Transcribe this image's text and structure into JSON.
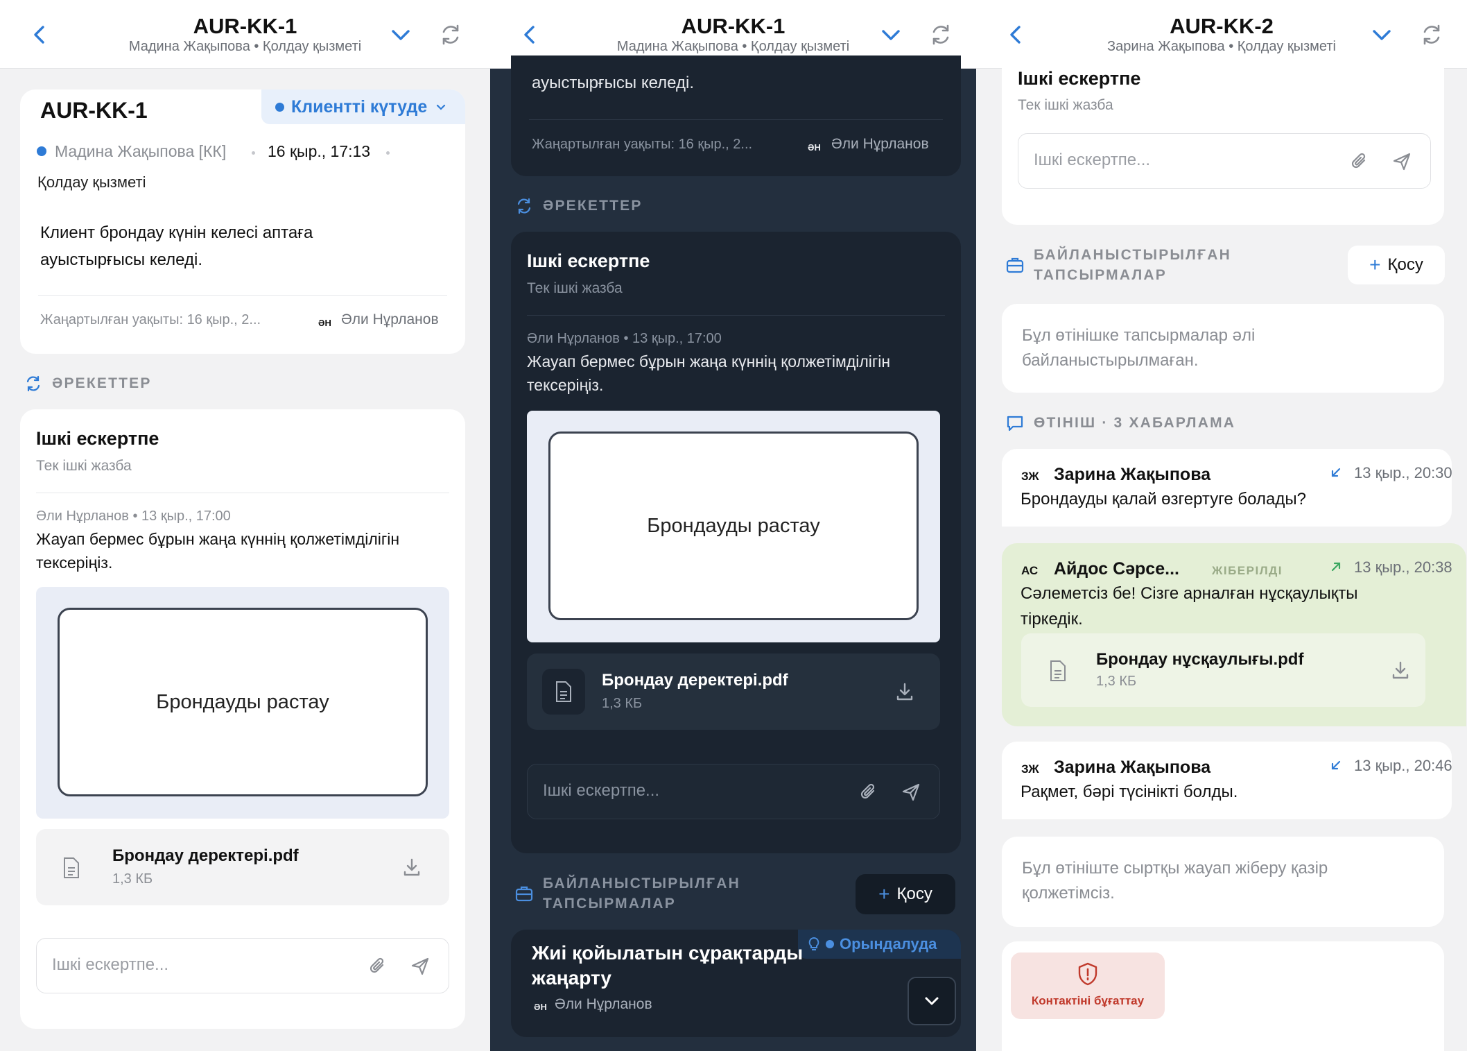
{
  "colors": {
    "accent": "#2e7bd6",
    "light_bg": "#f2f2f3",
    "dark_bg": "#232f3e",
    "dark_card": "#1b2430",
    "green_bubble": "#e4efd6",
    "danger": "#c0392b"
  },
  "panel1": {
    "header": {
      "title": "AUR-KK-1",
      "subtitle": "Мадина Жақыпова • Қолдау қызметі"
    },
    "ticket": {
      "id": "AUR-KK-1",
      "status": "Клиентті күтуде",
      "customer": "Мадина Жақыпова [КК]",
      "datetime": "16 қыр., 17:13",
      "department": "Қолдау қызметі",
      "message_line1": "Клиент брондау күнін келесі аптаға",
      "message_line2": "ауыстырғысы келеді.",
      "updated": "Жаңартылған уақыты: 16 қыр., 2...",
      "assignee_initials": "ӘН",
      "assignee": "Әли Нұрланов"
    },
    "actions_label": "ӘРЕКЕТТЕР",
    "note": {
      "title": "Ішкі ескертпе",
      "subtitle": "Тек ішкі жазба",
      "meta": "Әли Нұрланов • 13 қыр., 17:00",
      "text_line1": "Жауап бермес бұрын жаңа күннің қолжетімділігін",
      "text_line2": "тексеріңіз.",
      "image_button": "Брондауды растау",
      "file_name": "Брондау деректері.pdf",
      "file_size": "1,3 КБ",
      "input_placeholder": "Ішкі ескертпе..."
    }
  },
  "panel2": {
    "header": {
      "title": "AUR-KK-1",
      "subtitle": "Мадина Жақыпова • Қолдау қызметі"
    },
    "top_text": "ауыстырғысы келеді.",
    "updated": "Жаңартылған уақыты: 16 қыр., 2...",
    "assignee_initials": "ӘН",
    "assignee": "Әли Нұрланов",
    "actions_label": "ӘРЕКЕТТЕР",
    "note": {
      "title": "Ішкі ескертпе",
      "subtitle": "Тек ішкі жазба",
      "meta": "Әли Нұрланов • 13 қыр., 17:00",
      "text_line1": "Жауап бермес бұрын жаңа күннің қолжетімділігін",
      "text_line2": "тексеріңіз.",
      "image_button": "Брондауды растау",
      "file_name": "Брондау деректері.pdf",
      "file_size": "1,3 КБ",
      "input_placeholder": "Ішкі ескертпе..."
    },
    "linked_tasks_label_1": "БАЙЛАНЫСТЫРЫЛҒАН",
    "linked_tasks_label_2": "ТАПСЫРМАЛАР",
    "add_button": "Қосу",
    "task": {
      "title_line1": "Жиі қойылатын сұрақтарды",
      "title_line2": "жаңарту",
      "status": "Орындалуда",
      "assignee_initials": "ӘН",
      "assignee": "Әли Нұрланов"
    }
  },
  "panel3": {
    "header": {
      "title": "AUR-KK-2",
      "subtitle": "Зарина Жақыпова • Қолдау қызметі"
    },
    "note": {
      "title": "Ішкі ескертпе",
      "subtitle": "Тек ішкі жазба",
      "input_placeholder": "Ішкі ескертпе..."
    },
    "linked_tasks_label_1": "БАЙЛАНЫСТЫРЫЛҒАН",
    "linked_tasks_label_2": "ТАПСЫРМАЛАР",
    "add_button": "Қосу",
    "no_tasks_line1": "Бұл өтінішке тапсырмалар әлі",
    "no_tasks_line2": "байланыстырылмаған.",
    "thread_label": "ӨТІНІШ · 3 ХАБАРЛАМА",
    "messages": [
      {
        "initials": "ЗЖ",
        "author": "Зарина Жақыпова",
        "time": "13 қыр., 20:30",
        "line1": "Брондауды қалай өзгертуге болады?",
        "line2": ""
      },
      {
        "initials": "АС",
        "author": "Айдос Сәрсе...",
        "sent_label": "ЖІБЕРІЛДІ",
        "time": "13 қыр., 20:38",
        "line1": "Сәлеметсіз бе! Сізге арналған нұсқаулықты",
        "line2": "тіркедік.",
        "file_name": "Брондау нұсқаулығы.pdf",
        "file_size": "1,3 КБ"
      },
      {
        "initials": "ЗЖ",
        "author": "Зарина Жақыпова",
        "time": "13 қыр., 20:46",
        "line1": "Рақмет, бәрі түсінікті болды.",
        "line2": ""
      }
    ],
    "reply_disabled_line1": "Бұл өтініште сыртқы жауап жіберу қазір",
    "reply_disabled_line2": "қолжетімсіз.",
    "block_button": "Контактіні бұғаттау"
  }
}
